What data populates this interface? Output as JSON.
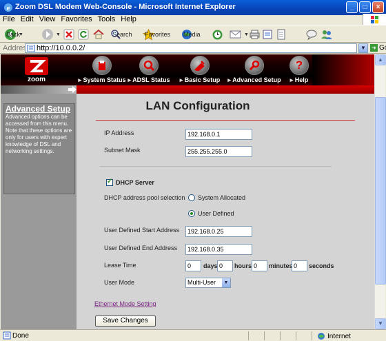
{
  "window": {
    "title": "Zoom DSL Modem Web-Console - Microsoft Internet Explorer"
  },
  "menu": [
    "File",
    "Edit",
    "View",
    "Favorites",
    "Tools",
    "Help"
  ],
  "toolbar": {
    "back": "Back",
    "search": "Search",
    "favorites": "Favorites",
    "media": "Media"
  },
  "address": {
    "label": "Address",
    "url": "http://10.0.0.2/",
    "go": "Go"
  },
  "nav": {
    "logo": "zoom",
    "items": [
      "System Status",
      "ADSL Status",
      "Basic Setup",
      "Advanced Setup",
      "Help"
    ]
  },
  "sidebar": {
    "title": "Advanced Setup",
    "description": "Advanced options can be accessed from this menu. Note that these options are only for users with expert knowledge of DSL and networking settings."
  },
  "page": {
    "title": "LAN Configuration",
    "ip_label": "IP Address",
    "ip_value": "192.168.0.1",
    "mask_label": "Subnet Mask",
    "mask_value": "255.255.255.0",
    "dhcp_label": "DHCP Server",
    "dhcp_checked": true,
    "pool_label": "DHCP address pool selection",
    "pool_opt1": "System Allocated",
    "pool_opt2": "User Defined",
    "pool_selected": "User Defined",
    "start_label": "User Defined Start Address",
    "start_value": "192.168.0.25",
    "end_label": "User Defined End Address",
    "end_value": "192.168.0.35",
    "lease_label": "Lease Time",
    "lease_days": "0",
    "lease_days_label": "days",
    "lease_hours": "0",
    "lease_hours_label": "hours",
    "lease_minutes": "0",
    "lease_minutes_label": "minutes",
    "lease_seconds": "0",
    "lease_seconds_label": "seconds",
    "mode_label": "User Mode",
    "mode_value": "Multi-User",
    "ethernet_link": "Ethernet Mode Setting",
    "save_button": "Save Changes"
  },
  "status": {
    "text": "Done",
    "zone": "Internet"
  },
  "colors": {
    "accent_red": "#c40000",
    "titlebar_blue": "#0a5fd8",
    "link_purple": "#7a2280"
  }
}
